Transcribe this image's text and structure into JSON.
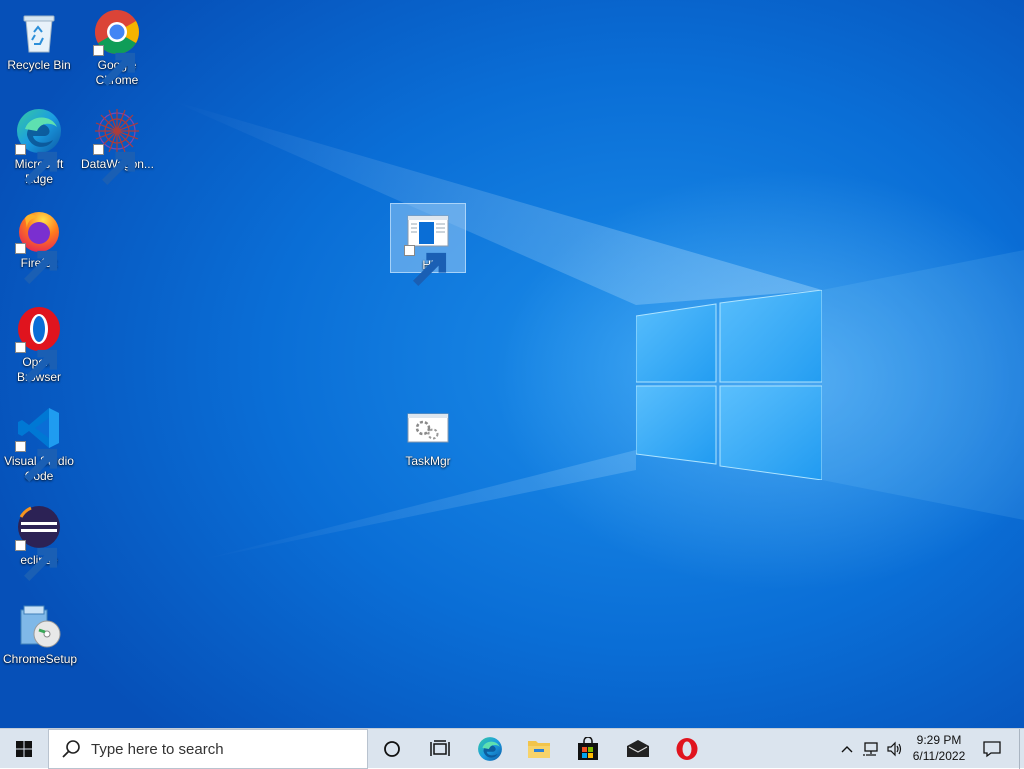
{
  "desktop": {
    "icons": [
      {
        "label": "Recycle Bin",
        "icon": "recycle-bin-icon"
      },
      {
        "label": "Google Chrome",
        "icon": "chrome-icon"
      },
      {
        "label": "Microsoft Edge",
        "icon": "edge-icon"
      },
      {
        "label": "DataWagon...",
        "icon": "datawagon-icon"
      },
      {
        "label": "Firefox",
        "icon": "firefox-icon"
      },
      {
        "label": "Opera Browser",
        "icon": "opera-icon"
      },
      {
        "label": "Visual Studio Code",
        "icon": "vscode-icon"
      },
      {
        "label": "eclipse",
        "icon": "eclipse-icon"
      },
      {
        "label": "ChromeSetup",
        "icon": "chrome-setup-icon"
      },
      {
        "label": "Hi",
        "icon": "window-app-icon",
        "selected": true
      },
      {
        "label": "TaskMgr",
        "icon": "task-manager-icon"
      }
    ],
    "wallpaper_colors": {
      "base": "#0a6ed6",
      "glow": "#7fd0ff"
    }
  },
  "taskbar": {
    "search_placeholder": "Type here to search",
    "pinned": [
      {
        "name": "cortana",
        "icon": "cortana-circle-icon"
      },
      {
        "name": "task-view",
        "icon": "task-view-icon"
      },
      {
        "name": "edge",
        "icon": "edge-icon"
      },
      {
        "name": "file-explorer",
        "icon": "folder-icon"
      },
      {
        "name": "microsoft-store",
        "icon": "store-bag-icon"
      },
      {
        "name": "mail",
        "icon": "mail-icon"
      },
      {
        "name": "opera",
        "icon": "opera-icon"
      }
    ],
    "tray": {
      "time": "9:29 PM",
      "date": "6/11/2022"
    },
    "background": "#dbe4ee"
  }
}
